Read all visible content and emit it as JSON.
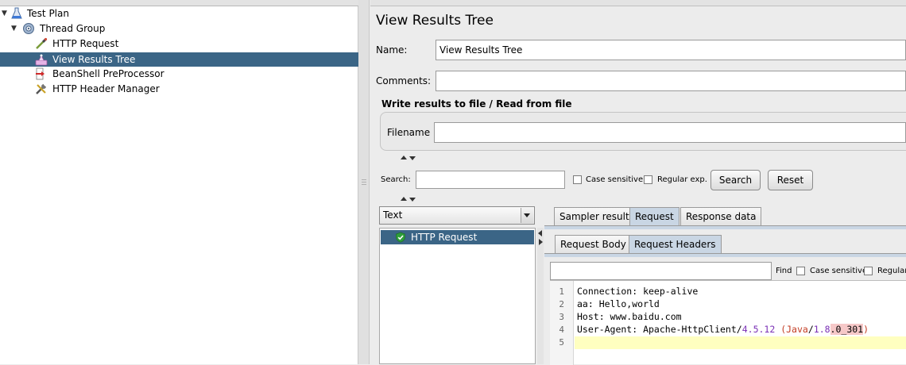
{
  "tree": {
    "items": [
      {
        "label": "Test Plan",
        "icon": "flask-icon",
        "expanded": true
      },
      {
        "label": "Thread Group",
        "icon": "gear-icon",
        "expanded": true
      },
      {
        "label": "HTTP Request",
        "icon": "pipette-icon"
      },
      {
        "label": "View Results Tree",
        "icon": "results-tree-icon",
        "selected": true
      },
      {
        "label": "BeanShell PreProcessor",
        "icon": "preprocessor-icon"
      },
      {
        "label": "HTTP Header Manager",
        "icon": "wrench-icon"
      }
    ]
  },
  "panel": {
    "title": "View Results Tree",
    "name_label": "Name:",
    "name_value": "View Results Tree",
    "comments_label": "Comments:",
    "comments_value": "",
    "file_section_title": "Write results to file / Read from file",
    "filename_label": "Filename",
    "filename_value": ""
  },
  "search": {
    "label": "Search:",
    "value": "",
    "case_sensitive_label": "Case sensitive",
    "regex_label": "Regular exp.",
    "search_button": "Search",
    "reset_button": "Reset"
  },
  "renderer": {
    "selected": "Text"
  },
  "results": {
    "items": [
      {
        "label": "HTTP Request",
        "status": "success",
        "icon": "shield-check-icon"
      }
    ]
  },
  "tabs": {
    "main": [
      "Sampler result",
      "Request",
      "Response data"
    ],
    "main_active": "Request",
    "sub": [
      "Request Body",
      "Request Headers"
    ],
    "sub_active": "Request Headers"
  },
  "find": {
    "value": "",
    "find_label": "Find",
    "case_sensitive_label": "Case sensitive",
    "regex_label": "Regular"
  },
  "editor": {
    "line_numbers": [
      "1",
      "2",
      "3",
      "4",
      "5"
    ],
    "lines": [
      "Connection: keep-alive",
      "aa: Hello,world",
      "Host: www.baidu.com",
      "User-Agent: Apache-HttpClient/4.5.12 (Java/1.8.0_301)",
      ""
    ],
    "ua_prefix": "User-Agent: Apache-HttpClient",
    "ua_slash1": "/",
    "ua_version": "4.5.12",
    "ua_open": " (Java",
    "ua_slash2": "/",
    "ua_java_ver_a": "1.8",
    "ua_java_ver_b": ".0_301",
    "ua_close": ")"
  },
  "colors": {
    "selection": "#3b6586",
    "active_tab": "#c9d6e4",
    "current_line": "#ffffc0",
    "success_icon": "#2e9e3a"
  }
}
